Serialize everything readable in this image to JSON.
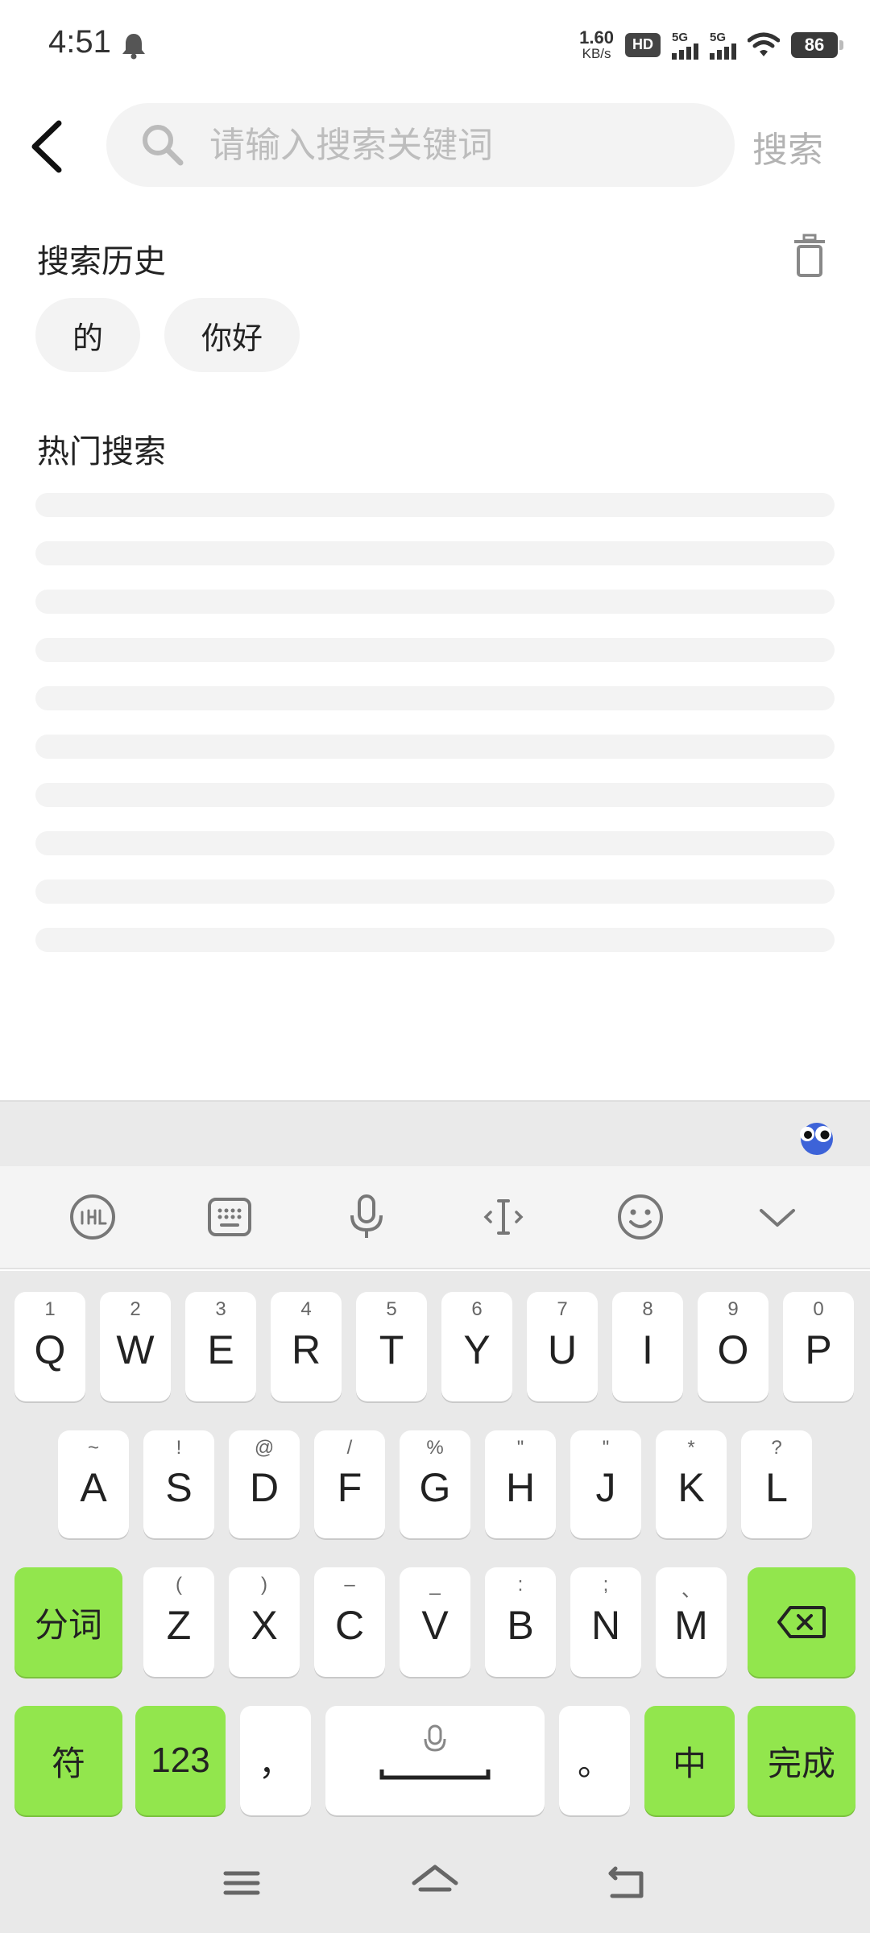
{
  "status": {
    "time": "4:51",
    "net_speed_value": "1.60",
    "net_speed_unit": "KB/s",
    "hd_label": "HD",
    "sim1_label": "5G",
    "sim2_label": "5G",
    "battery": "86"
  },
  "header": {
    "search_placeholder": "请输入搜索关键词",
    "search_button": "搜索"
  },
  "history": {
    "title": "搜索历史",
    "items": [
      "的",
      "你好"
    ]
  },
  "hot": {
    "title": "热门搜索",
    "loading_rows": 10
  },
  "keyboard": {
    "row1": [
      {
        "sub": "1",
        "key": "Q"
      },
      {
        "sub": "2",
        "key": "W"
      },
      {
        "sub": "3",
        "key": "E"
      },
      {
        "sub": "4",
        "key": "R"
      },
      {
        "sub": "5",
        "key": "T"
      },
      {
        "sub": "6",
        "key": "Y"
      },
      {
        "sub": "7",
        "key": "U"
      },
      {
        "sub": "8",
        "key": "I"
      },
      {
        "sub": "9",
        "key": "O"
      },
      {
        "sub": "0",
        "key": "P"
      }
    ],
    "row2": [
      {
        "sub": "~",
        "key": "A"
      },
      {
        "sub": "!",
        "key": "S"
      },
      {
        "sub": "@",
        "key": "D"
      },
      {
        "sub": "/",
        "key": "F"
      },
      {
        "sub": "%",
        "key": "G"
      },
      {
        "sub": "\"",
        "key": "H"
      },
      {
        "sub": "\"",
        "key": "J"
      },
      {
        "sub": "*",
        "key": "K"
      },
      {
        "sub": "?",
        "key": "L"
      }
    ],
    "row3": [
      {
        "sub": "(",
        "key": "Z"
      },
      {
        "sub": ")",
        "key": "X"
      },
      {
        "sub": "–",
        "key": "C"
      },
      {
        "sub": "_",
        "key": "V"
      },
      {
        "sub": ":",
        "key": "B"
      },
      {
        "sub": ";",
        "key": "N"
      },
      {
        "sub": "、",
        "key": "M"
      }
    ],
    "segment_key": "分词",
    "symbol_key": "符",
    "number_key": "123",
    "comma_key": "，",
    "period_key": "。",
    "lang_key": "中",
    "done_key": "完成"
  },
  "colors": {
    "accent_green": "#92e64d",
    "placeholder_gray": "#bdbdbd"
  }
}
